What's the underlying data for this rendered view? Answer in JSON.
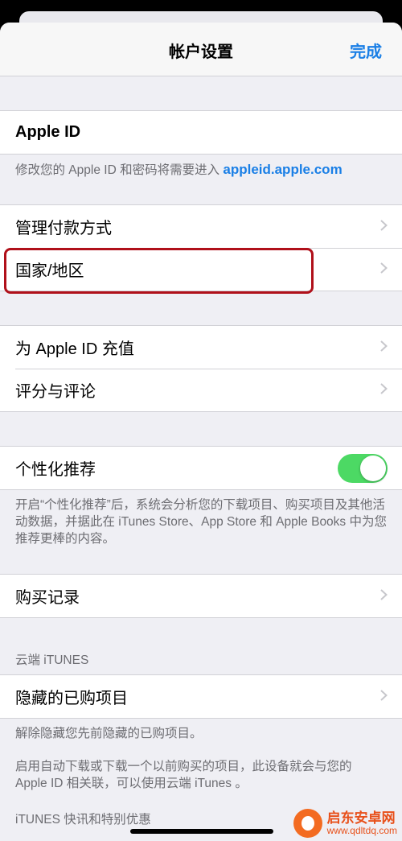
{
  "nav": {
    "title": "帐户设置",
    "done": "完成"
  },
  "apple_id": {
    "label": "Apple ID",
    "footer_text": "修改您的 Apple ID 和密码将需要进入 ",
    "footer_link": "appleid.apple.com"
  },
  "payment": {
    "manage_payment": "管理付款方式",
    "country_region": "国家/地区"
  },
  "topup": {
    "recharge": "为 Apple ID 充值",
    "ratings": "评分与评论"
  },
  "personalized": {
    "label": "个性化推荐",
    "toggle_on": true,
    "footer": "开启“个性化推荐”后，系统会分析您的下载项目、购买项目及其他活动数据，并据此在 iTunes Store、App Store 和 Apple Books 中为您推荐更棒的内容。"
  },
  "purchase_history": {
    "label": "购买记录"
  },
  "cloud": {
    "header": "云端 iTUNES",
    "hidden_purchases": "隐藏的已购项目",
    "footer1": "解除隐藏您先前隐藏的已购项目。",
    "footer2": "启用自动下载或下载一个以前购买的项目，此设备就会与您的 Apple ID 相关联，可以使用云端 iTunes 。"
  },
  "next_header": "iTUNES 快讯和特别优惠",
  "watermark": {
    "title": "启东安卓网",
    "url": "www.qdltdq.com"
  },
  "colors": {
    "accent": "#1a7fe6",
    "toggle": "#4cd964",
    "highlight": "#b0101a"
  }
}
